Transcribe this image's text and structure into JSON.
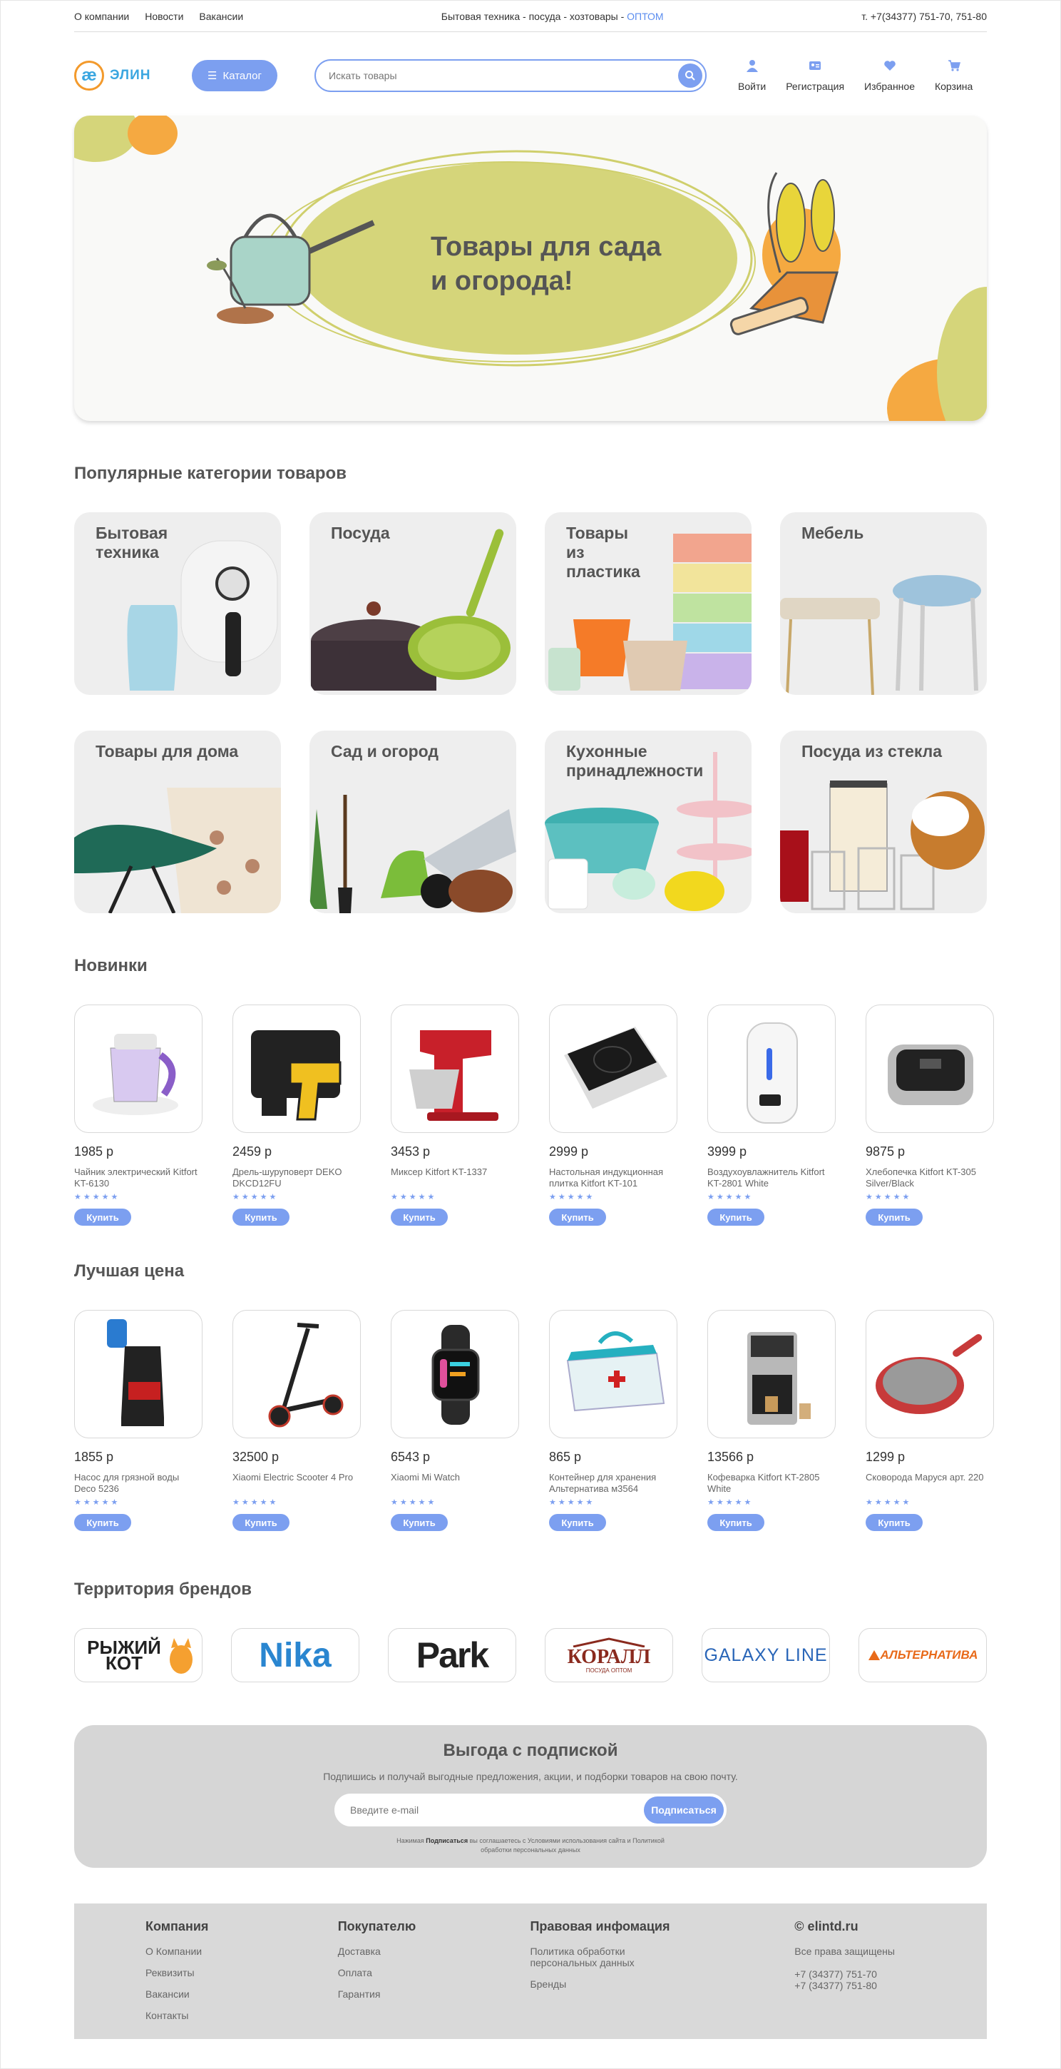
{
  "topbar": {
    "links": [
      "О компании",
      "Новости",
      "Вакансии"
    ],
    "tagline": "Бытовая техника - посуда - хозтовары - ",
    "tagline_accent": "ОПТОМ",
    "phone": "т. +7(34377) 751-70, 751-80"
  },
  "header": {
    "logo_mark": "ӕ",
    "logo_text": "ЭЛИН",
    "catalog_label": "Каталог",
    "search_placeholder": "Искать товары",
    "icons": [
      {
        "label": "Войти",
        "icon": "user-icon"
      },
      {
        "label": "Регистрация",
        "icon": "id-card-icon"
      },
      {
        "label": "Избранное",
        "icon": "heart-icon"
      },
      {
        "label": "Корзина",
        "icon": "cart-icon"
      }
    ]
  },
  "hero": {
    "title": "Товары для  сада\nи огорода!"
  },
  "categories": {
    "title": "Популярные категории товаров",
    "items": [
      {
        "label": "Бытовая\nтехника"
      },
      {
        "label": "Посуда"
      },
      {
        "label": "Товары\nиз\nпластика"
      },
      {
        "label": "Мебель"
      },
      {
        "label": "Товары для дома"
      },
      {
        "label": "Сад  и  огород"
      },
      {
        "label": "Кухонные\nпринадлежности"
      },
      {
        "label": "Посуда из стекла"
      }
    ]
  },
  "new_products": {
    "title": "Новинки",
    "items": [
      {
        "price": "1985 р",
        "name": "Чайник электрический Kitfort KT-6130",
        "buy": "Купить"
      },
      {
        "price": "2459 р",
        "name": "Дрель-шуруповерт DEKO DKCD12FU",
        "buy": "Купить"
      },
      {
        "price": "3453 р",
        "name": "Миксер Kitfort KT-1337",
        "buy": "Купить"
      },
      {
        "price": "2999 р",
        "name": "Настольная индукционная плитка Kitfort KT-101",
        "buy": "Купить"
      },
      {
        "price": "3999 р",
        "name": "Воздухоувлажнитель Kitfort KT-2801 White",
        "buy": "Купить"
      },
      {
        "price": "9875 р",
        "name": "Хлебопечка Kitfort KT-305 Silver/Black",
        "buy": "Купить"
      }
    ]
  },
  "best_price": {
    "title": "Лучшая цена",
    "items": [
      {
        "price": "1855 р",
        "name": "Насос для грязной воды Deco 5236",
        "buy": "Купить"
      },
      {
        "price": "32500 р",
        "name": "Xiaomi Electric Scooter 4 Pro",
        "buy": "Купить"
      },
      {
        "price": "6543 р",
        "name": "Xiaomi Mi Watch",
        "buy": "Купить"
      },
      {
        "price": "865 р",
        "name": "Контейнер для хранения Альтернатива м3564",
        "buy": "Купить"
      },
      {
        "price": "13566 р",
        "name": "Кофеварка Kitfort KT-2805 White",
        "buy": "Купить"
      },
      {
        "price": "1299 р",
        "name": "Сковорода  Маруся арт. 220",
        "buy": "Купить"
      }
    ]
  },
  "rating_stars": "★★★★★",
  "brands": {
    "title": "Территория брендов",
    "items": [
      "РЫЖИЙ КОТ",
      "Nika",
      "Park",
      "КОРАЛЛ",
      "GALAXY LINE",
      "АЛЬТЕРНАТИВА"
    ],
    "korall_sub": "ПОСУДА ОПТОМ"
  },
  "subscribe": {
    "title": "Выгода с подпиской",
    "text": "Подпишись и получай выгодные предложения, акции, и подборки товаров на свою почту.",
    "placeholder": "Введите e-mail",
    "button": "Подписаться",
    "note_prefix": "Нажимая ",
    "note_bold": "Подписаться",
    "note_suffix": " вы соглашаетесь с Условиями использования сайта и Политикой обработки персональных данных"
  },
  "footer": {
    "company": {
      "title": "Компания",
      "items": [
        "О Компании",
        "Реквизиты",
        "Вакансии",
        "Контакты"
      ]
    },
    "buyer": {
      "title": "Покупателю",
      "items": [
        "Доставка",
        "Оплата",
        "Гарантия"
      ]
    },
    "legal": {
      "title": "Правовая инфомация",
      "items": [
        "Политика обработки персональных данных",
        "Бренды"
      ]
    },
    "site": {
      "title": "© elintd.ru",
      "rights": "Все права защищены",
      "phones": [
        "+7 (34377) 751-70",
        "+7 (34377) 751-80"
      ]
    }
  },
  "colors": {
    "accent": "#7c9ff0",
    "hero_yellow": "#d5d57a",
    "hero_orange": "#f5a941",
    "card_bg": "#eeeeee",
    "footer_bg": "#d9d9d9"
  }
}
